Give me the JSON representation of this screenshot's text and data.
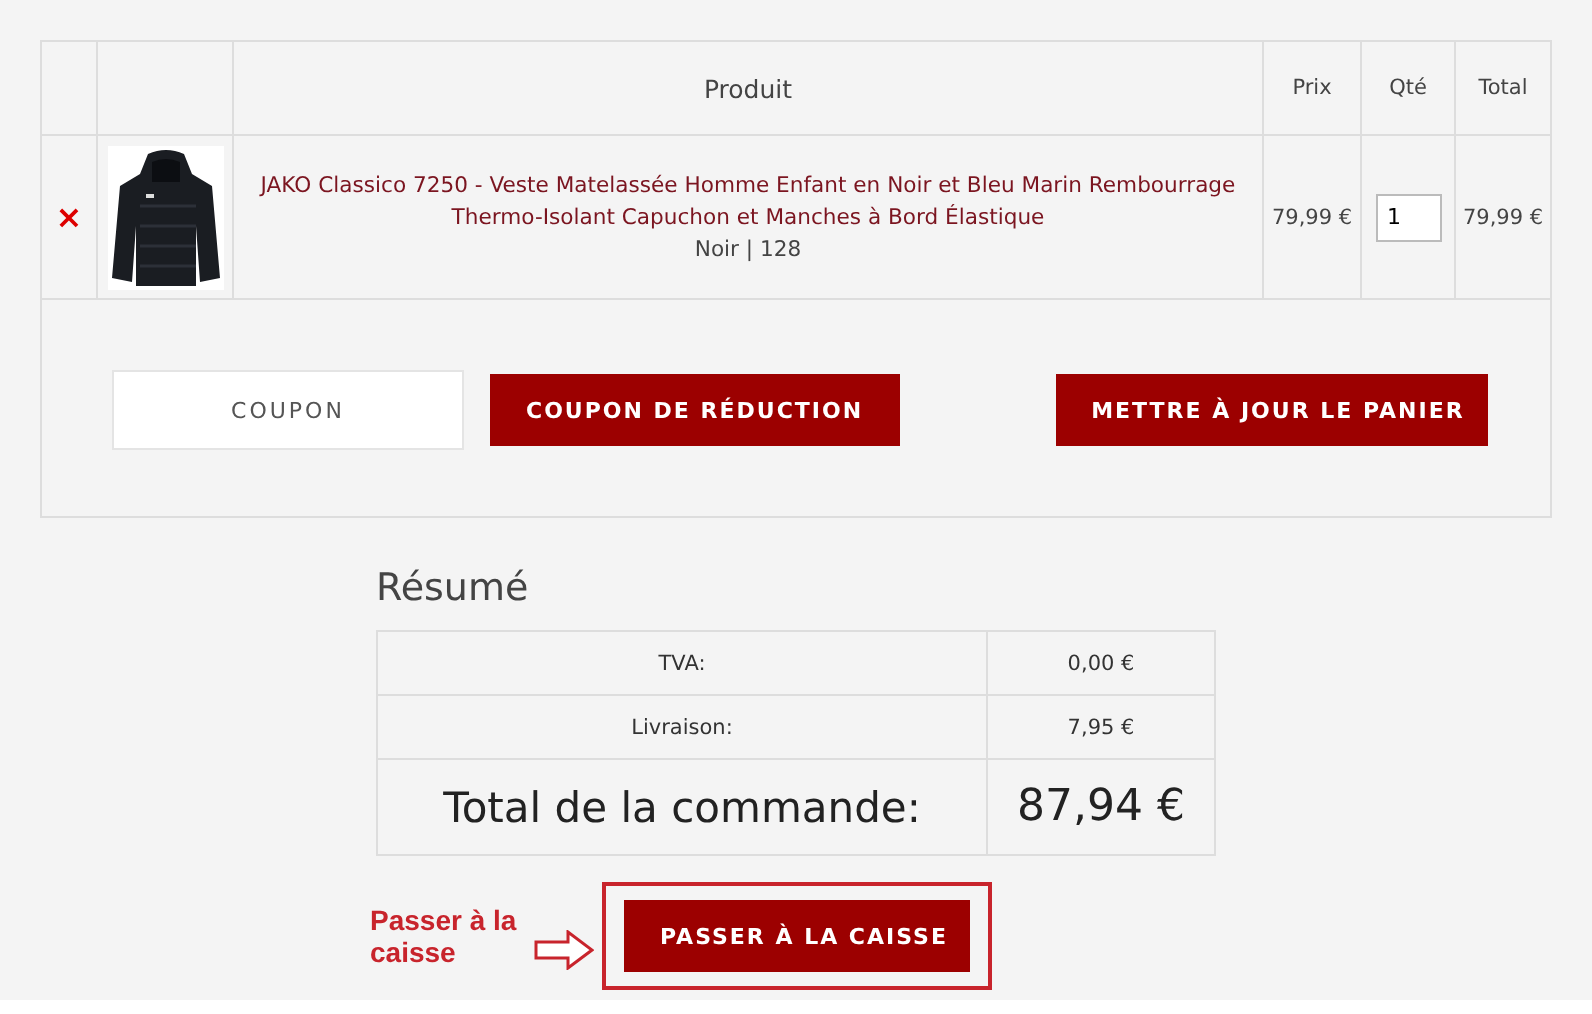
{
  "cart": {
    "columns": [
      "Produit",
      "Prix",
      "Qté",
      "Total"
    ],
    "rows": [
      {
        "remove": "×",
        "product": "JAKO Classico 7250 - Veste Matelassée Homme Enfant en Noir et Bleu Marin Rembourrage Thermo-Isolant Capuchon et Manches à Bord Élastique",
        "variant": "Noir | 128",
        "price": "79,99 €",
        "quantity": "1",
        "total": "79,99 €"
      }
    ],
    "coupon": {
      "placeholder": "COUPON"
    },
    "buttons": [
      "COUPON DE RÉDUCTION",
      "METTRE À JOUR LE PANIER"
    ]
  },
  "summary": {
    "title": "Résumé",
    "rows": [
      {
        "kind": "line",
        "label": "TVA:",
        "value": "0,00 €"
      },
      {
        "kind": "line",
        "label": "Livraison:",
        "value": "7,95 €"
      },
      {
        "kind": "total",
        "label": "Total de la commande:",
        "value": "87,94 €"
      }
    ],
    "checkout_button": "PASSER À LA CAISSE",
    "annotation": "Passer à la caisse"
  }
}
